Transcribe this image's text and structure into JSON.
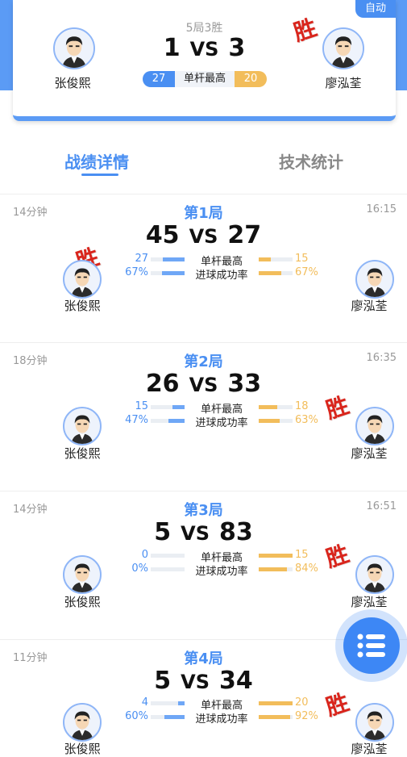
{
  "header": {
    "auto_badge": "自动",
    "subtitle": "5局3胜",
    "score_left": "1",
    "vs": "VS",
    "score_right": "3",
    "player_left": "张俊熙",
    "player_right": "廖泓荃",
    "win_mark": "胜",
    "high_break_left": "27",
    "high_break_label": "单杆最高",
    "high_break_right": "20"
  },
  "tabs": [
    {
      "label": "战绩详情",
      "active": true
    },
    {
      "label": "技术统计",
      "active": false
    }
  ],
  "labels": {
    "high_break": "单杆最高",
    "pot_rate": "进球成功率",
    "vs": "VS",
    "win": "胜",
    "player_left": "张俊熙",
    "player_right": "廖泓荃"
  },
  "games": [
    {
      "title": "第1局",
      "duration": "14分钟",
      "time": "16:15",
      "score_left": "45",
      "score_right": "27",
      "hb_left": "27",
      "hb_right": "15",
      "pr_left": "67%",
      "pr_right": "67%",
      "hb_left_frac": 0.65,
      "hb_right_frac": 0.35,
      "pr_left_frac": 0.67,
      "pr_right_frac": 0.67,
      "winner": "left"
    },
    {
      "title": "第2局",
      "duration": "18分钟",
      "time": "16:35",
      "score_left": "26",
      "score_right": "33",
      "hb_left": "15",
      "hb_right": "18",
      "pr_left": "47%",
      "pr_right": "63%",
      "hb_left_frac": 0.35,
      "hb_right_frac": 0.55,
      "pr_left_frac": 0.47,
      "pr_right_frac": 0.63,
      "winner": "right"
    },
    {
      "title": "第3局",
      "duration": "14分钟",
      "time": "16:51",
      "score_left": "5",
      "score_right": "83",
      "hb_left": "0",
      "hb_right": "15",
      "pr_left": "0%",
      "pr_right": "84%",
      "hb_left_frac": 0.0,
      "hb_right_frac": 1.0,
      "pr_left_frac": 0.0,
      "pr_right_frac": 0.84,
      "winner": "right"
    },
    {
      "title": "第4局",
      "duration": "11分钟",
      "time": "",
      "score_left": "5",
      "score_right": "34",
      "hb_left": "4",
      "hb_right": "20",
      "pr_left": "60%",
      "pr_right": "92%",
      "hb_left_frac": 0.2,
      "hb_right_frac": 1.0,
      "pr_left_frac": 0.6,
      "pr_right_frac": 0.92,
      "winner": "right"
    }
  ],
  "colors": {
    "accent": "#4a8ff2",
    "left": "#6fa7f6",
    "right": "#f2bd5b",
    "win": "#d9251c"
  }
}
